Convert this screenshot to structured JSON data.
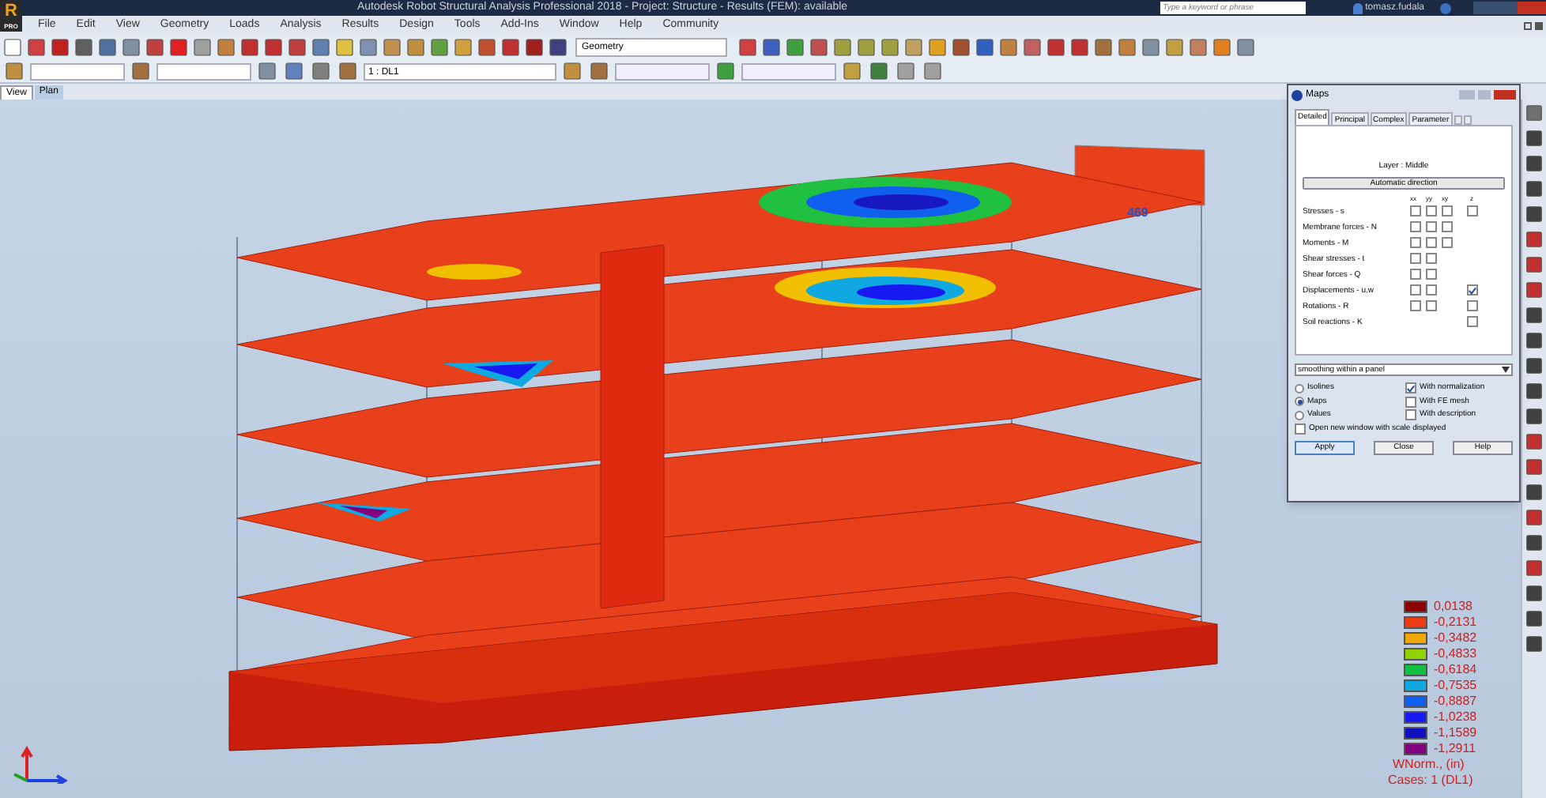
{
  "window": {
    "title": "Autodesk Robot Structural Analysis Professional 2018 - Project: Structure - Results (FEM): available",
    "search": {
      "placeholder": "Type a keyword or phrase"
    },
    "user": "tomasz.fudala",
    "logo": "R",
    "logo_sub": "PRO"
  },
  "menu": [
    "File",
    "Edit",
    "View",
    "Geometry",
    "Loads",
    "Analysis",
    "Results",
    "Design",
    "Tools",
    "Add-Ins",
    "Window",
    "Help",
    "Community"
  ],
  "toolbar": {
    "layout_combo": "Geometry",
    "case_combo": "1 : DL1"
  },
  "view_tabs": [
    {
      "label": "View",
      "selected": true
    },
    {
      "label": "Plan",
      "selected": false
    }
  ],
  "viewport": {
    "dimension_label": "469"
  },
  "maps": {
    "title": "Maps",
    "tabs": [
      {
        "label": "Detailed",
        "selected": true
      },
      {
        "label": "Principal",
        "selected": false
      },
      {
        "label": "Complex",
        "selected": false
      },
      {
        "label": "Parameter",
        "selected": false
      }
    ],
    "layer": "Layer : Middle",
    "direction_button": "Automatic direction",
    "columns": [
      "xx",
      "yy",
      "xy",
      "z"
    ],
    "rows": [
      {
        "label": "Stresses - s",
        "checks": {
          "xx": false,
          "yy": false,
          "xy": false,
          "z": false
        }
      },
      {
        "label": "Membrane forces - N",
        "checks": {
          "xx": false,
          "yy": false,
          "xy": false
        }
      },
      {
        "label": "Moments - M",
        "checks": {
          "xx": false,
          "yy": false,
          "xy": false
        }
      },
      {
        "label": "Shear stresses - t",
        "checks": {
          "xx": false,
          "yy": false
        }
      },
      {
        "label": "Shear forces - Q",
        "checks": {
          "xx": false,
          "yy": false
        }
      },
      {
        "label": "Displacements - u,w",
        "checks": {
          "xx": false,
          "yy": false,
          "z": true
        }
      },
      {
        "label": "Rotations - R",
        "checks": {
          "xx": false,
          "yy": false,
          "z": false
        }
      },
      {
        "label": "Soil reactions - K",
        "checks": {
          "z": false
        }
      }
    ],
    "smoothing": "smoothing within a panel",
    "modes": [
      {
        "label": "Isolines",
        "selected": false
      },
      {
        "label": "Maps",
        "selected": true
      },
      {
        "label": "Values",
        "selected": false
      }
    ],
    "options": [
      {
        "label": "With normalization",
        "checked": true
      },
      {
        "label": "With FE mesh",
        "checked": false
      },
      {
        "label": "With description",
        "checked": false
      }
    ],
    "new_window": {
      "label": "Open new window with scale displayed",
      "checked": false
    },
    "buttons": [
      "Apply",
      "Close",
      "Help"
    ]
  },
  "legend": {
    "items": [
      {
        "value": "0,0138",
        "color": "#8b0000"
      },
      {
        "value": "-0,2131",
        "color": "#ee3a10"
      },
      {
        "value": "-0,3482",
        "color": "#f0a800"
      },
      {
        "value": "-0,4833",
        "color": "#8fd400"
      },
      {
        "value": "-0,6184",
        "color": "#10c040"
      },
      {
        "value": "-0,7535",
        "color": "#10a8e0"
      },
      {
        "value": "-0,8887",
        "color": "#1060f0"
      },
      {
        "value": "-1,0238",
        "color": "#1818f0"
      },
      {
        "value": "-1,1589",
        "color": "#1010c0"
      },
      {
        "value": "-1,2911",
        "color": "#800080"
      }
    ],
    "unit": "WNorm., (in)",
    "cases": "Cases: 1 (DL1)"
  }
}
